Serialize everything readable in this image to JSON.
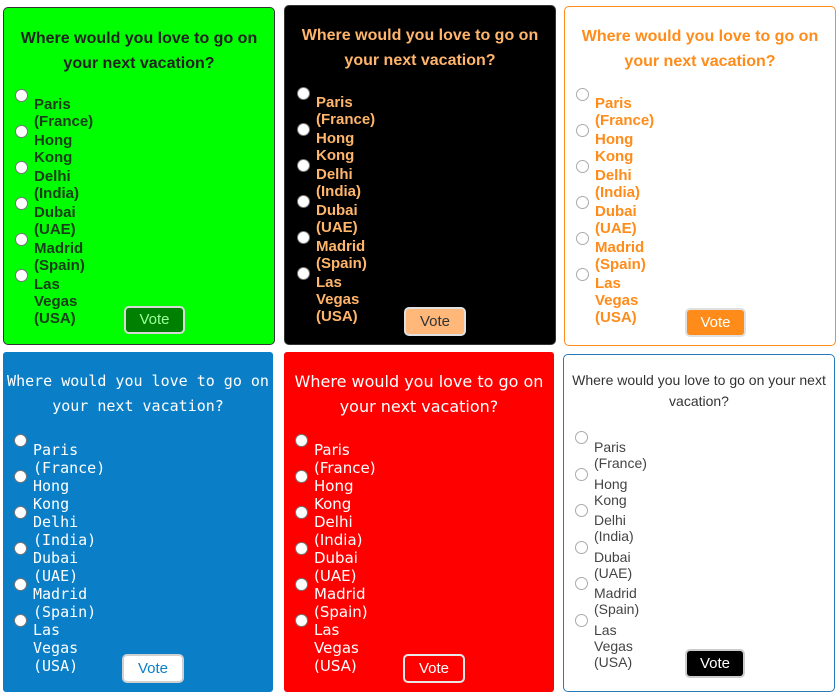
{
  "question": "Where would you love to go on your next vacation?",
  "options": [
    "Paris (France)",
    "Hong Kong",
    "Delhi (India)",
    "Dubai (UAE)",
    "Madrid (Spain)",
    "Las Vegas (USA)"
  ],
  "vote_label": "Vote",
  "cards": [
    {
      "id": "c1",
      "theme": "green",
      "background": "#00ff00",
      "text_color": "#1a3d1a",
      "button_color": "#008000"
    },
    {
      "id": "c2",
      "theme": "black",
      "background": "#000000",
      "text_color": "#ffb56b",
      "button_color": "#ffb77a"
    },
    {
      "id": "c3",
      "theme": "white-orange",
      "background": "#ffffff",
      "text_color": "#ff8c1a",
      "button_color": "#ff8c1a"
    },
    {
      "id": "c4",
      "theme": "blue",
      "background": "#0a7fc7",
      "text_color": "#ffffff",
      "button_color": "#ffffff"
    },
    {
      "id": "c5",
      "theme": "red",
      "background": "#ff0000",
      "text_color": "#ffffff",
      "button_color": "#ff0000"
    },
    {
      "id": "c6",
      "theme": "white-plain",
      "background": "#ffffff",
      "text_color": "#444444",
      "button_color": "#000000"
    }
  ]
}
